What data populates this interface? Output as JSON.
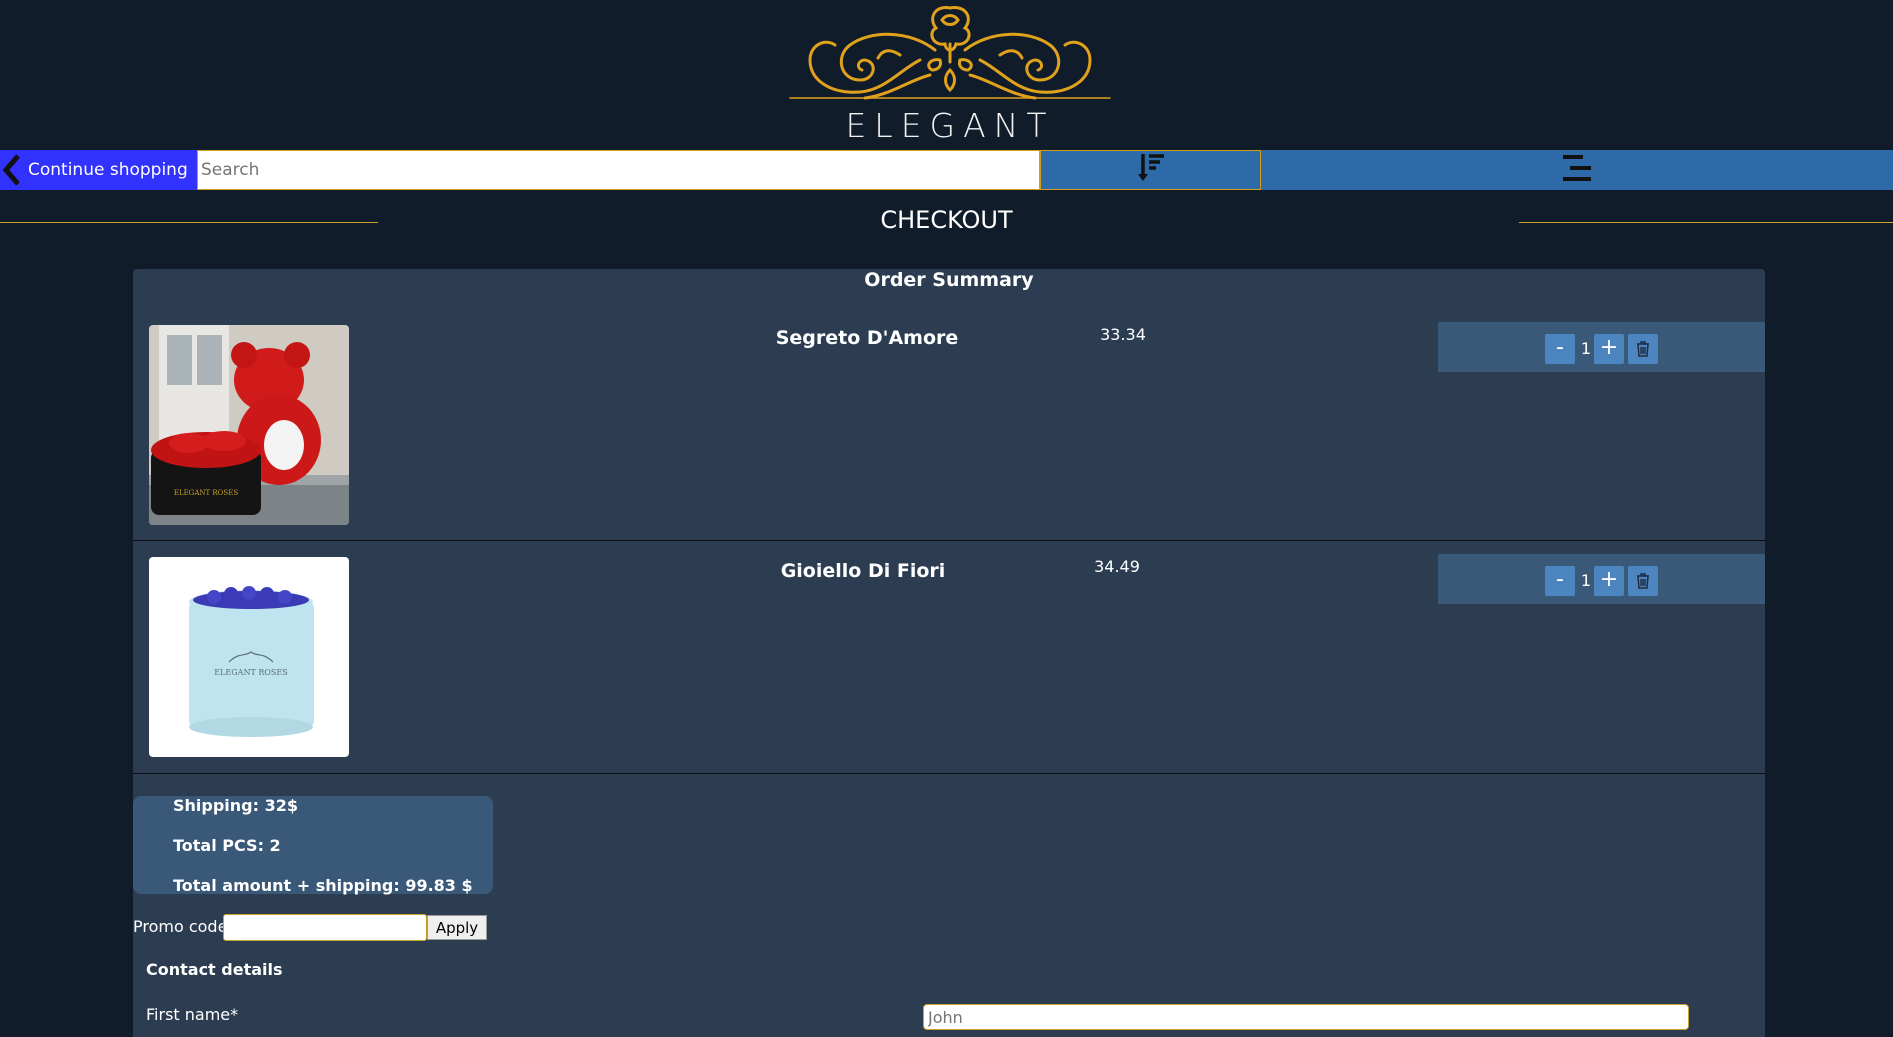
{
  "brand": {
    "name": "ELEGANT ROSES",
    "accent_color": "#e0a21c"
  },
  "topbar": {
    "continue_label": "Continue shopping",
    "search_placeholder": "Search",
    "sort_icon": "sort-down-icon",
    "menu_icon": "menu-icon"
  },
  "checkout": {
    "title": "CHECKOUT",
    "order_summary_title": "Order Summary"
  },
  "items": [
    {
      "name": "Segreto D'Amore",
      "price": "33.34",
      "quantity": "1",
      "image": "red rose teddy bear with heart box"
    },
    {
      "name": "Gioiello Di Fiori",
      "price": "34.49",
      "quantity": "1",
      "image": "light blue round box with purple roses"
    }
  ],
  "qty_controls": {
    "minus": "-",
    "plus": "+",
    "delete_icon": "trash-icon"
  },
  "totals": {
    "shipping": "Shipping: 32$",
    "total_pcs": "Total PCS: 2",
    "total_amount": "Total amount + shipping: 99.83 $"
  },
  "promo": {
    "label": "Promo code",
    "value": "",
    "apply_label": "Apply"
  },
  "contact": {
    "title": "Contact details",
    "first_name_label": "First name*",
    "first_name_placeholder": "John"
  }
}
